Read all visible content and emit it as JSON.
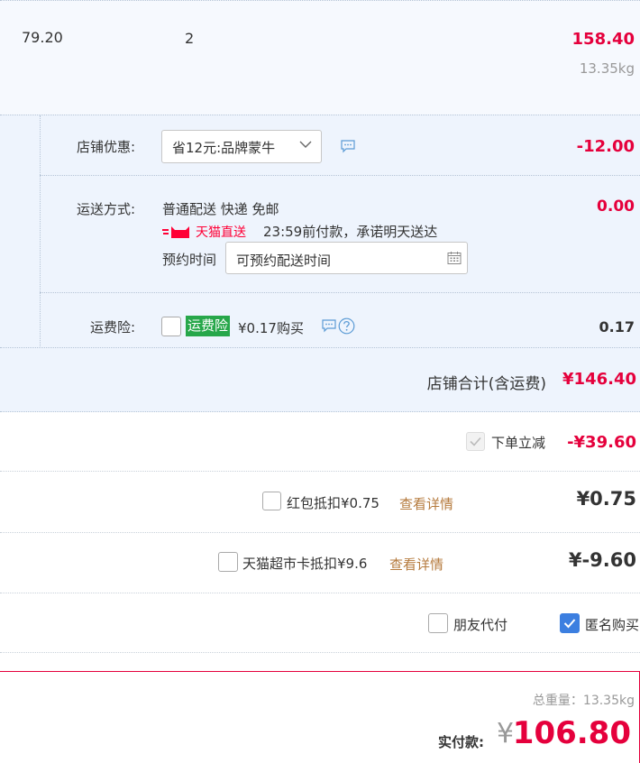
{
  "item": {
    "unit_price": "79.20",
    "quantity": "2",
    "subtotal": "158.40",
    "weight": "13.35kg"
  },
  "shop_discount": {
    "label": "店铺优惠:",
    "selected": "省12元:品牌蒙牛",
    "amount": "-12.00"
  },
  "delivery": {
    "label": "运送方式:",
    "method": "普通配送 快递 免邮",
    "badge": "天猫直送",
    "promise": "23:59前付款，承诺明天送达",
    "appointment_label": "预约时间",
    "appointment_placeholder": "可预约配送时间",
    "amount": "0.00"
  },
  "insurance": {
    "label": "运费险:",
    "tag": "运费险",
    "price_text": "¥0.17购买",
    "amount": "0.17"
  },
  "shop_total": {
    "label": "店铺合计(含运费)",
    "value": "¥146.40"
  },
  "instant_discount": {
    "label": "下单立减",
    "amount": "-¥39.60",
    "checked": true
  },
  "red_packet": {
    "label": "红包抵扣¥0.75",
    "link": "查看详情",
    "amount": "¥0.75"
  },
  "supermarket_card": {
    "label": "天猫超市卡抵扣¥9.6",
    "link": "查看详情",
    "amount": "¥-9.60"
  },
  "options": {
    "friend_pay_label": "朋友代付",
    "anonymous_label": "匿名购买",
    "anonymous_checked": true
  },
  "footer": {
    "weight_text": "总重量：13.35kg",
    "pay_label": "实付款:",
    "currency": "¥",
    "pay_amount": "106.80"
  },
  "colors": {
    "price_red": "#e5003c",
    "panel_bg": "#eef4fd",
    "link": "#b57a3d",
    "insurance_green": "#27a74a",
    "checkbox_blue": "#3c7fe0"
  }
}
